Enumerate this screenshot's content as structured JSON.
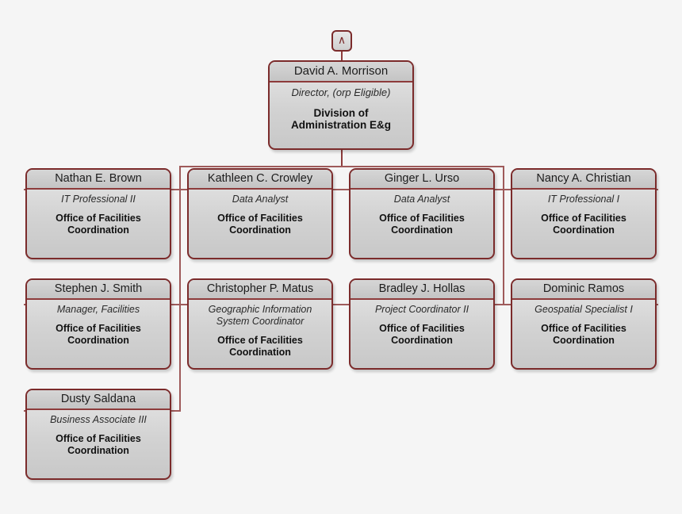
{
  "chart": {
    "background_color": "#f5f5f5",
    "node_border_color": "#7b2b2b",
    "connector_color": "#9e5a5a",
    "department_default": "Office of Facilities\nCoordination"
  },
  "collapse_pin": {
    "icon": "chevron-up-icon",
    "glyph": "∧",
    "tooltip": "Collapse upward"
  },
  "root": {
    "name": "David A. Morrison",
    "title": "Director, (orp Eligible)",
    "dept_line1": "Division of",
    "dept_line2": "Administration E&g"
  },
  "row1": [
    {
      "name": "Nathan E. Brown",
      "title": "IT Professional II",
      "dept_line1": "Office of Facilities",
      "dept_line2": "Coordination"
    },
    {
      "name": "Kathleen C. Crowley",
      "title": "Data Analyst",
      "dept_line1": "Office of Facilities",
      "dept_line2": "Coordination"
    },
    {
      "name": "Ginger L. Urso",
      "title": "Data Analyst",
      "dept_line1": "Office of Facilities",
      "dept_line2": "Coordination"
    },
    {
      "name": "Nancy A. Christian",
      "title": "IT Professional I",
      "dept_line1": "Office of Facilities",
      "dept_line2": "Coordination"
    }
  ],
  "row2": [
    {
      "name": "Stephen J. Smith",
      "title": "Manager, Facilities",
      "title_line2": "",
      "dept_line1": "Office of Facilities",
      "dept_line2": "Coordination"
    },
    {
      "name": "Christopher P. Matus",
      "title": "Geographic Information",
      "title_line2": "System Coordinator",
      "dept_line1": "Office of Facilities",
      "dept_line2": "Coordination"
    },
    {
      "name": "Bradley J. Hollas",
      "title": "Project Coordinator II",
      "title_line2": "",
      "dept_line1": "Office of Facilities",
      "dept_line2": "Coordination"
    },
    {
      "name": "Dominic Ramos",
      "title": "Geospatial Specialist I",
      "title_line2": "",
      "dept_line1": "Office of Facilities",
      "dept_line2": "Coordination"
    }
  ],
  "row3": [
    {
      "name": "Dusty Saldana",
      "title": "Business Associate III",
      "dept_line1": "Office of Facilities",
      "dept_line2": "Coordination"
    }
  ]
}
